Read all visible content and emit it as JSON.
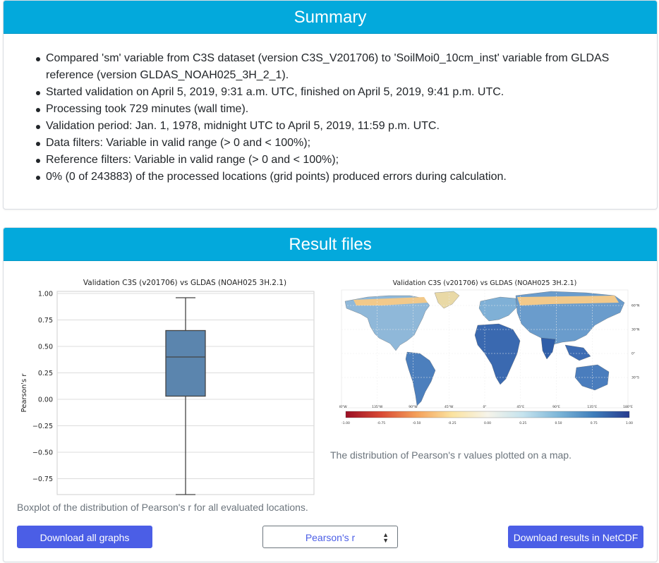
{
  "summary": {
    "title": "Summary",
    "items": [
      "Compared 'sm' variable from C3S dataset (version C3S_V201706) to 'SoilMoi0_10cm_inst' variable from GLDAS",
      "reference (version GLDAS_NOAH025_3H_2_1).",
      "Started validation on April 5, 2019, 9:31 a.m. UTC, finished on April 5, 2019, 9:41 p.m. UTC.",
      "Processing took 729 minutes (wall time).",
      "Validation period: Jan. 1, 1978, midnight UTC to April 5, 2019, 11:59 p.m. UTC.",
      "Data filters: Variable in valid range (> 0 and < 100%);",
      "Reference filters: Variable in valid range (> 0 and < 100%);",
      "0% (0 of 243883) of the processed locations (grid points) produced errors during calculation."
    ]
  },
  "results": {
    "title": "Result files",
    "boxplot_caption": "Boxplot of the distribution of Pearson's r for all evaluated locations.",
    "map_caption": "The distribution of Pearson's r values plotted on a map.",
    "download_graphs_label": "Download all graphs",
    "metric_select_value": "Pearson's r",
    "download_netcdf_label": "Download results in NetCDF"
  },
  "map": {
    "title": "Validation C3S (v201706) vs GLDAS (NOAH025 3H.2.1)",
    "lon_ticks": [
      "180°W",
      "135°W",
      "90°W",
      "45°W",
      "0°",
      "45°E",
      "90°E",
      "135°E",
      "180°E"
    ],
    "lat_ticks": [
      "60°N",
      "30°N",
      "0°",
      "30°S"
    ],
    "colorbar_ticks": [
      "-1.00",
      "-0.75",
      "-0.50",
      "-0.25",
      "0.00",
      "0.25",
      "0.50",
      "0.75",
      "1.00"
    ],
    "colormap": [
      "#9a0f24",
      "#d94a35",
      "#f4a05a",
      "#fbe3a0",
      "#f6f4ea",
      "#c5e3ee",
      "#7db6d8",
      "#3f7dba",
      "#273c8f"
    ]
  },
  "chart_data": {
    "type": "boxplot",
    "title": "Validation C3S (v201706) vs GLDAS (NOAH025 3H.2.1)",
    "ylabel": "Pearson's r",
    "xlabel": "",
    "ylim": [
      -0.9,
      1.02
    ],
    "yticks": [
      1.0,
      0.75,
      0.5,
      0.25,
      0.0,
      -0.25,
      -0.5,
      -0.75
    ],
    "ytick_labels": [
      "1.00",
      "0.75",
      "0.50",
      "0.25",
      "0.00",
      "−0.25",
      "−0.50",
      "−0.75"
    ],
    "grid": true,
    "box_color": "#5b85ae",
    "stats": {
      "whisker_low": -0.9,
      "q1": 0.03,
      "median": 0.4,
      "q3": 0.65,
      "whisker_high": 0.96
    }
  }
}
